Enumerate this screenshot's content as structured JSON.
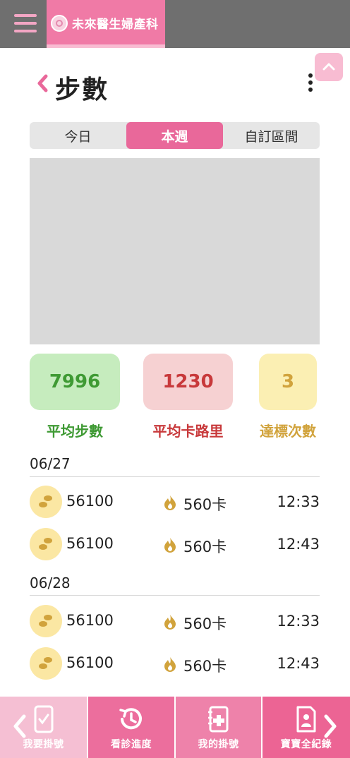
{
  "topbar": {
    "brand_name": "未來醫生婦產科",
    "menu_icon": "hamburger-menu-icon",
    "brand_logo_icon": "clinic-logo-icon"
  },
  "header": {
    "title": "步數",
    "back_icon": "chevron-left-icon",
    "more_icon": "more-vertical-icon",
    "scroll_top_icon": "chevron-up-icon"
  },
  "tabs": [
    {
      "label": "今日",
      "active": false
    },
    {
      "label": "本週",
      "active": true
    },
    {
      "label": "自訂區間",
      "active": false
    }
  ],
  "stats": [
    {
      "value": "7996",
      "label": "平均步數",
      "color": "#3f9a34",
      "bg": "#c6ecbe"
    },
    {
      "value": "1230",
      "label": "平均卡路里",
      "color": "#c8393b",
      "bg": "#f6d1d2"
    },
    {
      "value": "3",
      "label": "達標次數",
      "color": "#d1a33c",
      "bg": "#fbefb3"
    }
  ],
  "records": [
    {
      "date": "06/27",
      "rows": [
        {
          "steps": "56100",
          "calories": "560卡",
          "time": "12:33"
        },
        {
          "steps": "56100",
          "calories": "560卡",
          "time": "12:43"
        }
      ]
    },
    {
      "date": "06/28",
      "rows": [
        {
          "steps": "56100",
          "calories": "560卡",
          "time": "12:33"
        },
        {
          "steps": "56100",
          "calories": "560卡",
          "time": "12:43"
        }
      ]
    }
  ],
  "bottom_nav": [
    {
      "label": "我要掛號",
      "icon": "phone-check-icon"
    },
    {
      "label": "看診進度",
      "icon": "clock-history-icon"
    },
    {
      "label": "我的掛號",
      "icon": "medical-notebook-icon"
    },
    {
      "label": "寶寶全紀錄",
      "icon": "baby-record-icon"
    }
  ],
  "colors": {
    "accent_pink": "#e9689a",
    "topbar_gray": "#6f6f6f",
    "badge_yellow": "#fbe7a3",
    "flame_gold": "#d1a33c"
  }
}
